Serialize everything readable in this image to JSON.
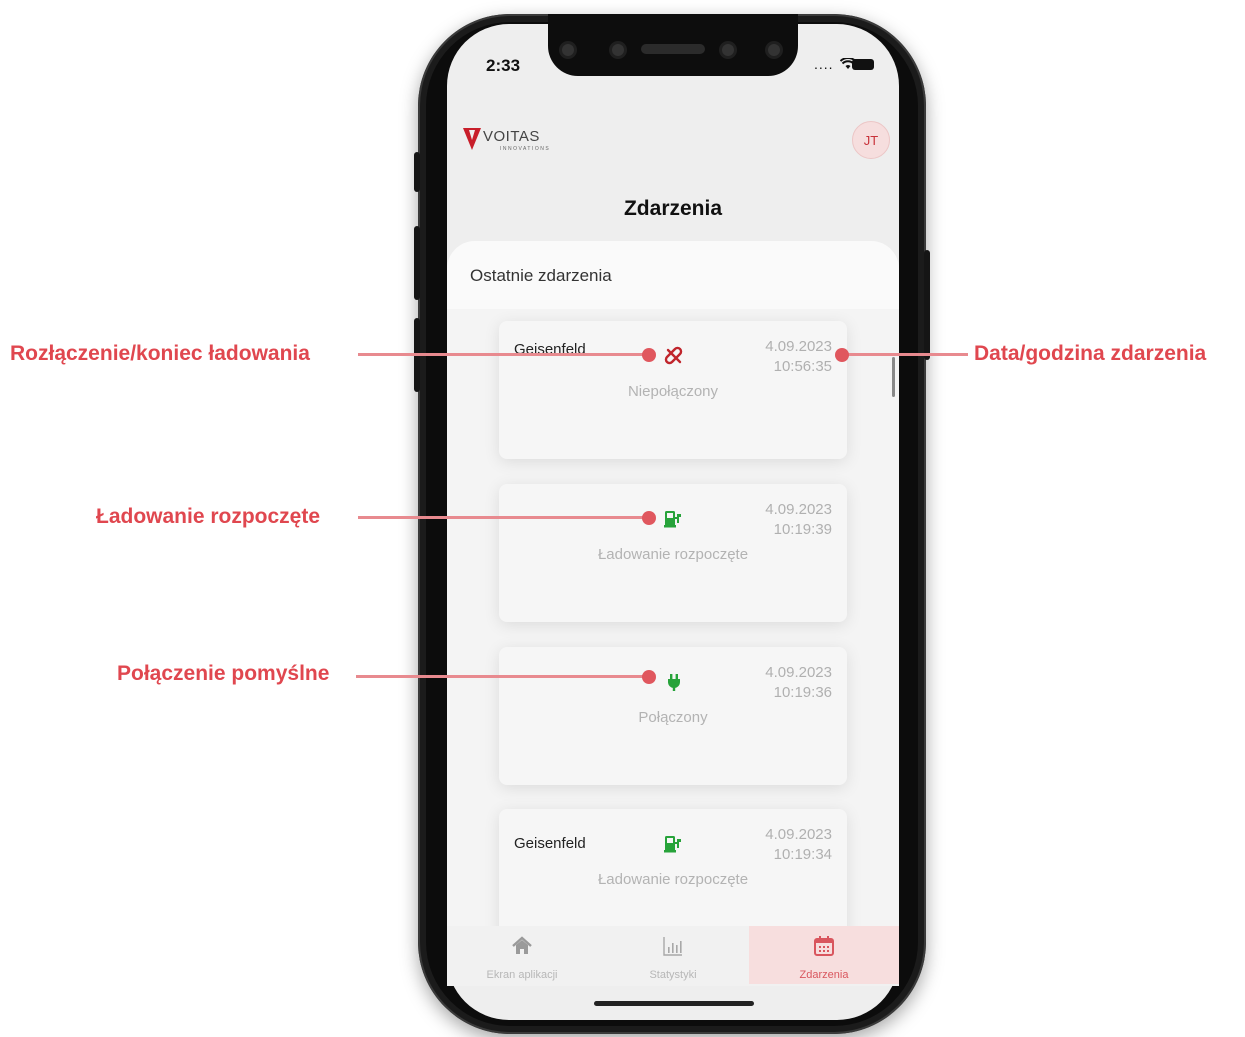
{
  "status_bar": {
    "time": "2:33",
    "signal": "....",
    "wifi_icon": "wifi-icon",
    "battery_icon": "battery-icon"
  },
  "header": {
    "logo_text": "VOITAS",
    "logo_subtext": "INNOVATIONS",
    "avatar_initials": "JT",
    "title": "Zdarzenia"
  },
  "section_title": "Ostatnie zdarzenia",
  "events": [
    {
      "site": "Geisenfeld",
      "icon": "unplugged-icon",
      "icon_color": "#c0252c",
      "date": "4.09.2023",
      "time": "10:56:35",
      "status": "Niepołączony"
    },
    {
      "site": "",
      "icon": "charging-started-icon",
      "icon_color": "#27a33a",
      "date": "4.09.2023",
      "time": "10:19:39",
      "status": "Ładowanie rozpoczęte"
    },
    {
      "site": "",
      "icon": "plug-icon",
      "icon_color": "#27a33a",
      "date": "4.09.2023",
      "time": "10:19:36",
      "status": "Połączony"
    },
    {
      "site": "Geisenfeld",
      "icon": "charging-started-icon",
      "icon_color": "#27a33a",
      "date": "4.09.2023",
      "time": "10:19:34",
      "status": "Ładowanie rozpoczęte"
    }
  ],
  "nav": [
    {
      "label": "Ekran aplikacji",
      "icon": "home-icon",
      "active": false
    },
    {
      "label": "Statystyki",
      "icon": "bar-chart-icon",
      "active": false
    },
    {
      "label": "Zdarzenia",
      "icon": "calendar-icon",
      "active": true
    }
  ],
  "annotations": {
    "disconnect": "Rozłączenie/koniec ładowania",
    "datetime": "Data/godzina zdarzenia",
    "charging_started": "Ładowanie rozpoczęte",
    "connected": "Połączenie pomyślne"
  },
  "colors": {
    "accent": "#e0474f",
    "brand_red": "#c81e2a",
    "success_green": "#27a33a"
  }
}
